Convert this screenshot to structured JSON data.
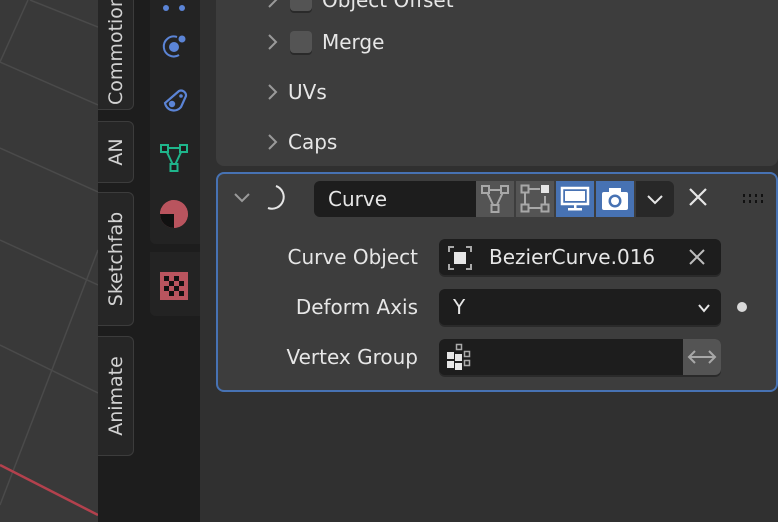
{
  "sidebar_tabs": [
    {
      "label": "Commotion"
    },
    {
      "label": "AN"
    },
    {
      "label": "Sketchfab"
    },
    {
      "label": "Animate"
    }
  ],
  "property_tabs": [
    {
      "name": "particles",
      "icon": "particles-icon",
      "color": "#5b84d6"
    },
    {
      "name": "physics",
      "icon": "physics-icon",
      "color": "#5b84d6"
    },
    {
      "name": "constraints",
      "icon": "object-constraint-icon",
      "color": "#5b84d6"
    },
    {
      "name": "data",
      "icon": "mesh-data-icon",
      "color": "#1fb58b"
    },
    {
      "name": "material",
      "icon": "material-icon",
      "color": "#b9545e"
    },
    {
      "name": "texture",
      "icon": "texture-icon",
      "color": "#b9545e"
    }
  ],
  "array_subpanels": [
    {
      "label": "Object Offset",
      "has_checkbox": true,
      "cut_off": true
    },
    {
      "label": "Merge",
      "has_checkbox": true
    },
    {
      "label": "UVs",
      "has_checkbox": false
    },
    {
      "label": "Caps",
      "has_checkbox": false
    }
  ],
  "modifier": {
    "name": "Curve",
    "type_icon": "curve-modifier-icon",
    "toggles": [
      {
        "name": "edit-mode-cage",
        "icon": "edit-mode-icon",
        "active": false
      },
      {
        "name": "edit-mode",
        "icon": "vertex-edit-icon",
        "active": false
      },
      {
        "name": "realtime",
        "icon": "monitor-icon",
        "active": true
      },
      {
        "name": "render",
        "icon": "camera-icon",
        "active": true
      }
    ],
    "properties": {
      "curve_object": {
        "label": "Curve Object",
        "value": "BezierCurve.016"
      },
      "deform_axis": {
        "label": "Deform Axis",
        "value": "Y"
      },
      "vertex_group": {
        "label": "Vertex Group",
        "value": "",
        "placeholder": ""
      }
    }
  },
  "colors": {
    "accent": "#4772b3",
    "active_toggle": "#4772b3",
    "x_axis": "#c4454f"
  }
}
